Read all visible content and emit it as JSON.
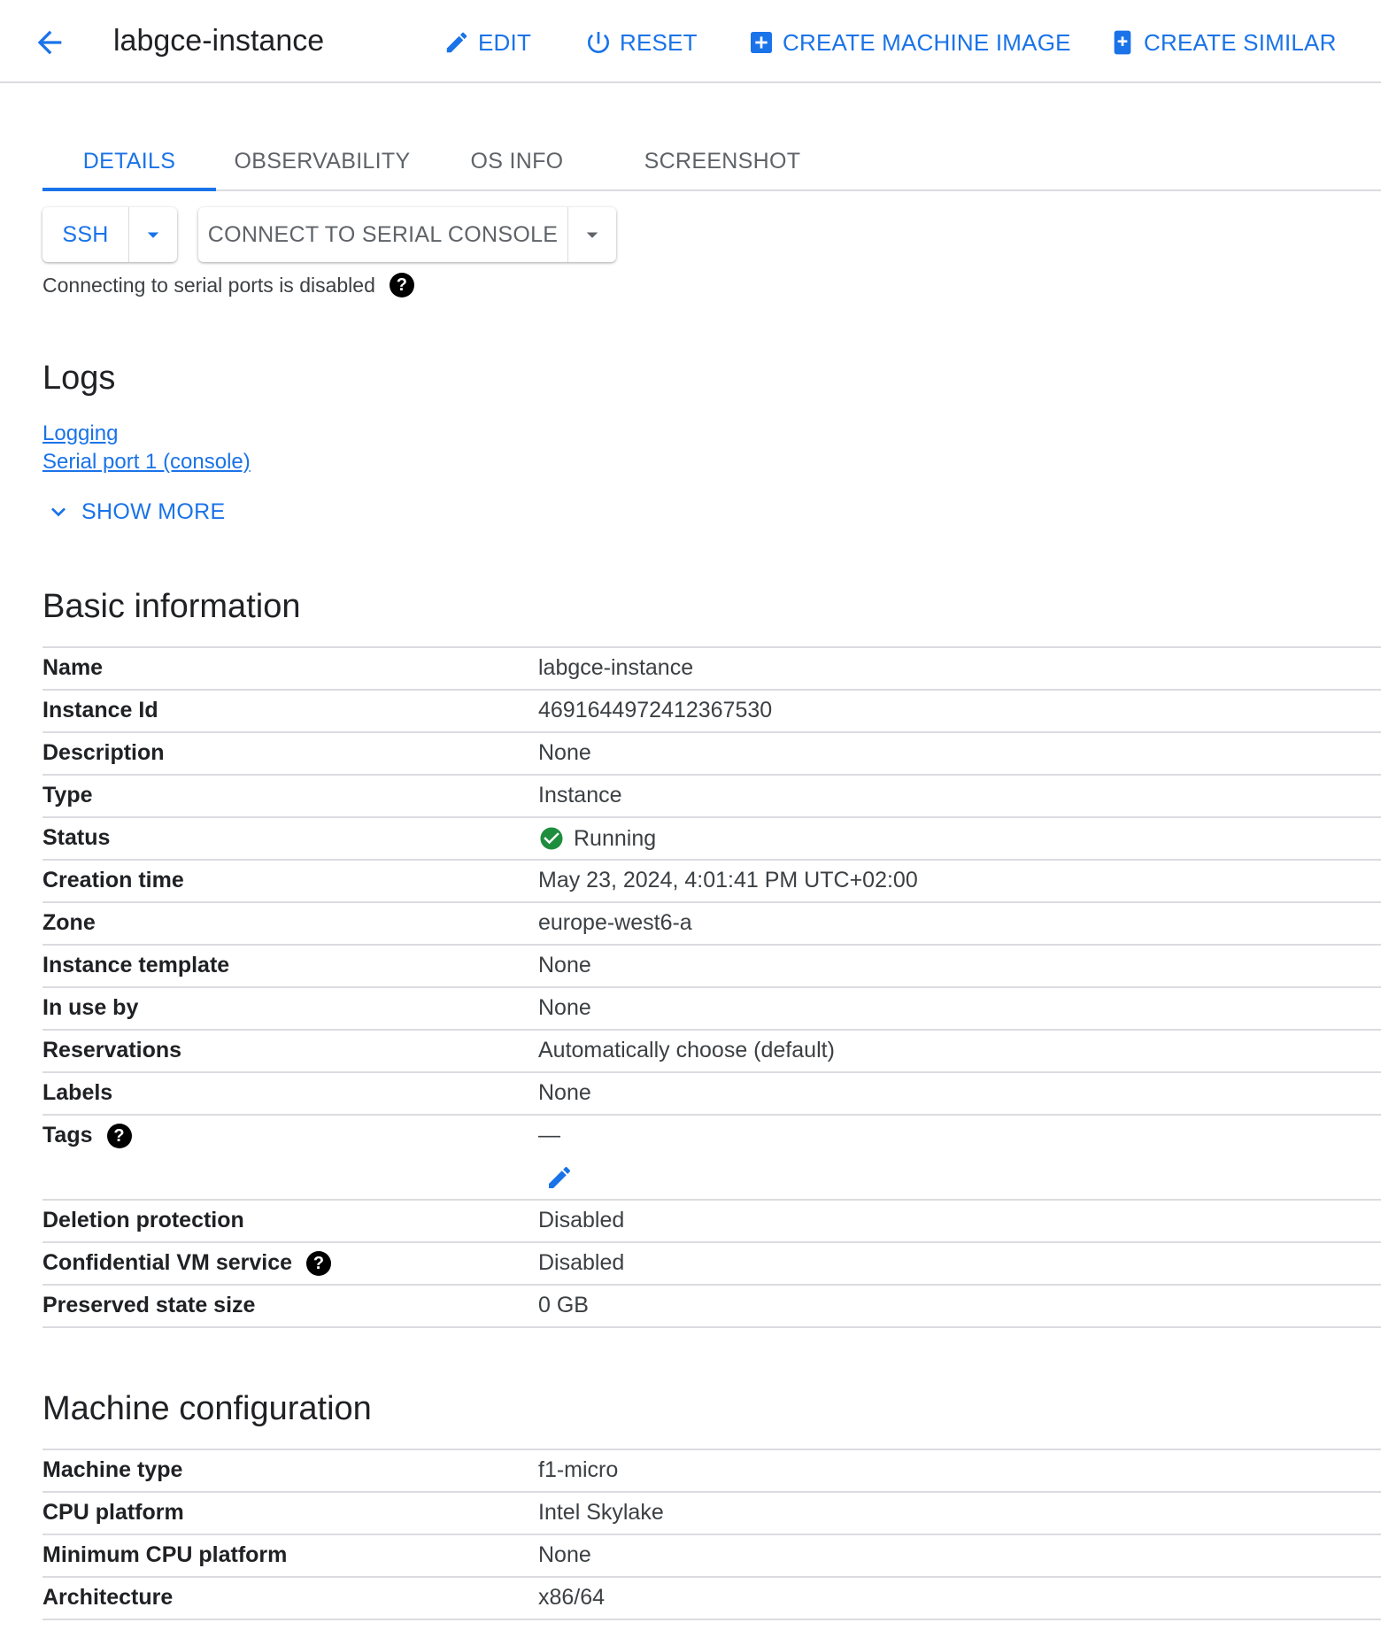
{
  "header": {
    "title": "labgce-instance",
    "edit_label": "EDIT",
    "reset_label": "RESET",
    "create_machine_image_label": "CREATE MACHINE IMAGE",
    "create_similar_label": "CREATE SIMILAR"
  },
  "tabs": [
    {
      "label": "DETAILS",
      "active": true
    },
    {
      "label": "OBSERVABILITY",
      "active": false
    },
    {
      "label": "OS INFO",
      "active": false
    },
    {
      "label": "SCREENSHOT",
      "active": false
    }
  ],
  "connect": {
    "ssh_label": "SSH",
    "serial_label": "CONNECT TO SERIAL CONSOLE",
    "serial_note": "Connecting to serial ports is disabled"
  },
  "logs": {
    "title": "Logs",
    "links": [
      "Logging",
      "Serial port 1 (console)"
    ],
    "show_more_label": "SHOW MORE"
  },
  "basic_info": {
    "title": "Basic information",
    "rows": [
      {
        "label": "Name",
        "value": "labgce-instance"
      },
      {
        "label": "Instance Id",
        "value": "4691644972412367530"
      },
      {
        "label": "Description",
        "value": "None"
      },
      {
        "label": "Type",
        "value": "Instance"
      },
      {
        "label": "Status",
        "value": "Running"
      },
      {
        "label": "Creation time",
        "value": "May 23, 2024, 4:01:41 PM UTC+02:00"
      },
      {
        "label": "Zone",
        "value": "europe-west6-a"
      },
      {
        "label": "Instance template",
        "value": "None"
      },
      {
        "label": "In use by",
        "value": "None"
      },
      {
        "label": "Reservations",
        "value": "Automatically choose (default)"
      },
      {
        "label": "Labels",
        "value": "None"
      },
      {
        "label": "Tags",
        "value": "—"
      },
      {
        "label": "Deletion protection",
        "value": "Disabled"
      },
      {
        "label": "Confidential VM service",
        "value": "Disabled"
      },
      {
        "label": "Preserved state size",
        "value": "0 GB"
      }
    ]
  },
  "machine_config": {
    "title": "Machine configuration",
    "rows": [
      {
        "label": "Machine type",
        "value": "f1-micro"
      },
      {
        "label": "CPU platform",
        "value": "Intel Skylake"
      },
      {
        "label": "Minimum CPU platform",
        "value": "None"
      },
      {
        "label": "Architecture",
        "value": "x86/64"
      }
    ]
  },
  "icons": {
    "back": "arrow-back-icon",
    "edit": "pencil-icon",
    "reset": "power-icon",
    "create_machine_image": "add-box-icon",
    "create_similar": "add-document-icon",
    "help": "help-icon",
    "status": "check-circle-icon",
    "dropdown": "arrow-drop-down-icon",
    "expand": "chevron-down-icon"
  },
  "colors": {
    "accent": "#1a73e8",
    "success": "#1e8e3e",
    "divider": "#dadce0",
    "text": "#202124",
    "secondary_text": "#5f6368"
  }
}
